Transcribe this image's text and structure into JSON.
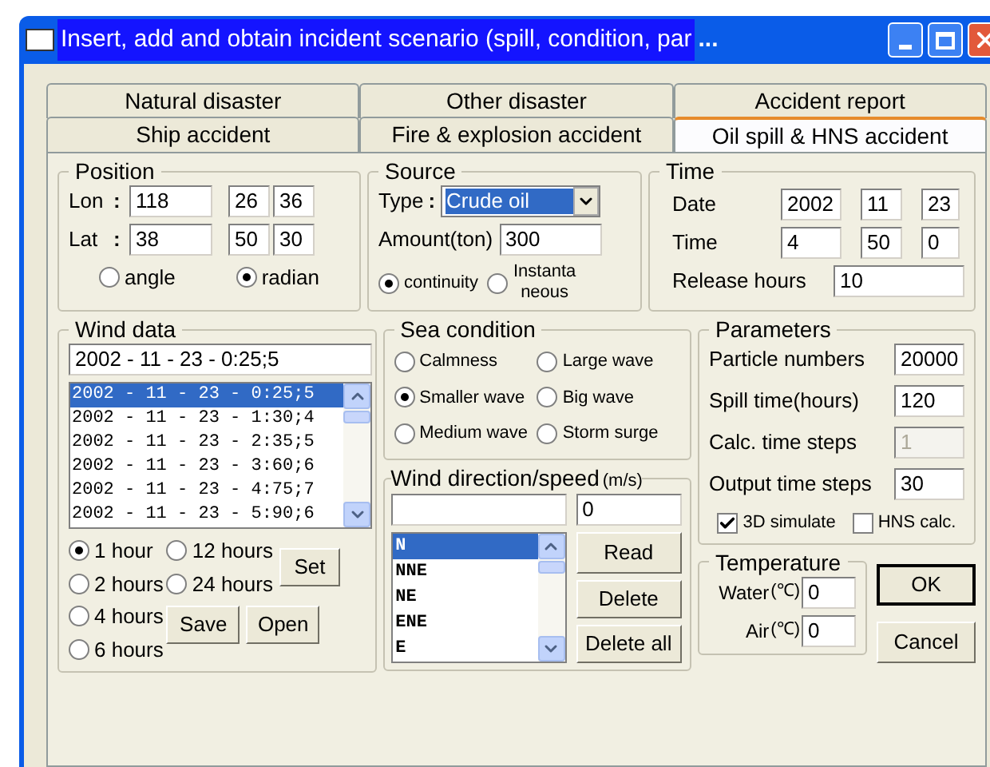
{
  "window": {
    "title": "Insert, add and obtain incident scenario (spill, condition, par",
    "ellipsis": "..."
  },
  "tab_rows": [
    {
      "tabs": [
        {
          "label": "Natural disaster",
          "selected": false
        },
        {
          "label": "Other disaster",
          "selected": false
        },
        {
          "label": "Accident report",
          "selected": false
        }
      ]
    },
    {
      "tabs": [
        {
          "label": "Ship accident",
          "selected": false
        },
        {
          "label": "Fire & explosion accident",
          "selected": false
        },
        {
          "label": "Oil spill & HNS accident",
          "selected": true
        }
      ]
    }
  ],
  "position": {
    "title": "Position",
    "rows": [
      {
        "label": "Lon",
        "sep": ":",
        "values": [
          "118",
          "26",
          "36"
        ]
      },
      {
        "label": "Lat",
        "sep": ":",
        "values": [
          "38",
          "50",
          "30"
        ]
      }
    ],
    "units": [
      {
        "label": "angle",
        "selected": false
      },
      {
        "label": "radian",
        "selected": true
      }
    ]
  },
  "source": {
    "title": "Source",
    "type_label": "Type",
    "sep": ":",
    "type_value": "Crude oil",
    "amount_label": "Amount(ton)",
    "amount_value": "300",
    "modes": [
      {
        "lines": [
          "continuity"
        ],
        "selected": true
      },
      {
        "lines": [
          "Instanta",
          "neous"
        ],
        "selected": false
      }
    ]
  },
  "time": {
    "title": "Time",
    "rows": [
      {
        "label": "Date",
        "values": [
          "2002",
          "11",
          "23"
        ]
      },
      {
        "label": "Time",
        "values": [
          "4",
          "50",
          "0"
        ]
      }
    ],
    "release_label": "Release hours",
    "release_value": "10"
  },
  "wind_data": {
    "title": "Wind data",
    "input_value": "2002 - 11 - 23 - 0:25;5",
    "entries": [
      {
        "text": "2002 - 11 - 23 - 0:25;5",
        "selected": true
      },
      {
        "text": "2002 - 11 - 23 - 1:30;4",
        "selected": false
      },
      {
        "text": "2002 - 11 - 23 - 2:35;5",
        "selected": false
      },
      {
        "text": "2002 - 11 - 23 - 3:60;6",
        "selected": false
      },
      {
        "text": "2002 - 11 - 23 - 4:75;7",
        "selected": false
      },
      {
        "text": "2002 - 11 - 23 - 5:90;6",
        "selected": false
      }
    ],
    "intervals_left": [
      {
        "label": "1 hour",
        "selected": true
      },
      {
        "label": "2 hours",
        "selected": false
      },
      {
        "label": "4 hours",
        "selected": false
      },
      {
        "label": "6 hours",
        "selected": false
      }
    ],
    "intervals_right": [
      {
        "label": "12 hours",
        "selected": false
      },
      {
        "label": "24 hours",
        "selected": false
      }
    ],
    "set_button": "Set",
    "save_button": "Save",
    "open_button": "Open"
  },
  "sea_condition": {
    "title": "Sea condition",
    "options": [
      {
        "label": "Calmness",
        "selected": false
      },
      {
        "label": "Large wave",
        "selected": false
      },
      {
        "label": "Smaller wave",
        "selected": true
      },
      {
        "label": "Big wave",
        "selected": false
      },
      {
        "label": "Medium wave",
        "selected": false
      },
      {
        "label": "Storm surge",
        "selected": false
      }
    ]
  },
  "wind_direction": {
    "title": "Wind direction/speed",
    "unit": "(m/s)",
    "speed_value": "0",
    "directions": [
      {
        "label": "N",
        "selected": true
      },
      {
        "label": "NNE",
        "selected": false
      },
      {
        "label": "NE",
        "selected": false
      },
      {
        "label": "ENE",
        "selected": false
      },
      {
        "label": "E",
        "selected": false
      }
    ],
    "buttons": [
      "Read",
      "Delete",
      "Delete all"
    ]
  },
  "parameters": {
    "title": "Parameters",
    "fields": [
      {
        "label": "Particle numbers",
        "value": "20000",
        "disabled": false
      },
      {
        "label": "Spill time(hours)",
        "value": "120",
        "disabled": false
      },
      {
        "label": "Calc. time steps",
        "value": "1",
        "disabled": true
      },
      {
        "label": "Output time steps",
        "value": "30",
        "disabled": false
      }
    ],
    "checks": [
      {
        "label": "3D simulate",
        "checked": true
      },
      {
        "label": "HNS calc.",
        "checked": false
      }
    ]
  },
  "temperature": {
    "title": "Temperature",
    "rows": [
      {
        "label": "Water",
        "unit": "(℃)",
        "value": "0"
      },
      {
        "label": "Air",
        "unit": "(℃)",
        "value": "0"
      }
    ]
  },
  "dialog_buttons": [
    {
      "label": "OK",
      "default": true
    },
    {
      "label": "Cancel",
      "default": false
    }
  ]
}
